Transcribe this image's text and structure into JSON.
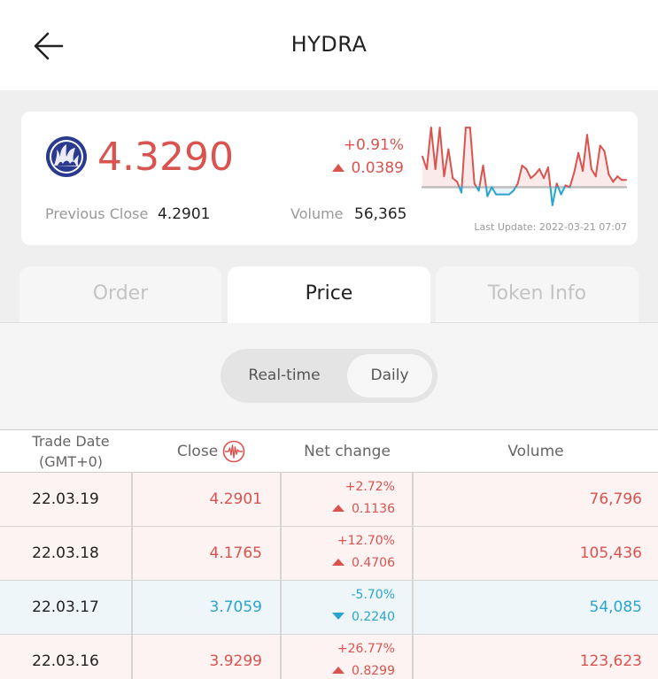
{
  "header": {
    "title": "HYDRA"
  },
  "summary": {
    "price": "4.3290",
    "change_percent": "+0.91%",
    "change_amount": "0.0389",
    "previous_close_label": "Previous Close",
    "previous_close": "4.2901",
    "volume_label": "Volume",
    "volume": "56,365",
    "last_update": "Last Update: 2022-03-21 07:07"
  },
  "tabs": [
    {
      "label": "Order",
      "active": false
    },
    {
      "label": "Price",
      "active": true
    },
    {
      "label": "Token Info",
      "active": false
    }
  ],
  "toggle": {
    "realtime_label": "Real-time",
    "daily_label": "Daily",
    "selected": "Daily"
  },
  "table": {
    "headers": {
      "trade_date_line1": "Trade Date",
      "trade_date_line2": "(GMT+0)",
      "close": "Close",
      "net_change": "Net change",
      "volume": "Volume"
    },
    "rows": [
      {
        "date": "22.03.19",
        "close": "4.2901",
        "pct": "+2.72%",
        "amount": "0.1136",
        "volume": "76,796",
        "direction": "up"
      },
      {
        "date": "22.03.18",
        "close": "4.1765",
        "pct": "+12.70%",
        "amount": "0.4706",
        "volume": "105,436",
        "direction": "up"
      },
      {
        "date": "22.03.17",
        "close": "3.7059",
        "pct": "-5.70%",
        "amount": "0.2240",
        "volume": "54,085",
        "direction": "down"
      },
      {
        "date": "22.03.16",
        "close": "3.9299",
        "pct": "+26.77%",
        "amount": "0.8299",
        "volume": "123,623",
        "direction": "up"
      }
    ]
  },
  "sparkline": {
    "baseline": 4.2901,
    "values": [
      4.46,
      4.39,
      4.62,
      4.39,
      4.62,
      4.35,
      4.5,
      4.34,
      4.32,
      4.26,
      4.62,
      4.62,
      4.31,
      4.27,
      4.41,
      4.24,
      4.29,
      4.25,
      4.25,
      4.25,
      4.25,
      4.27,
      4.31,
      4.41,
      4.39,
      4.34,
      4.36,
      4.39,
      4.34,
      4.4,
      4.19,
      4.31,
      4.25,
      4.3,
      4.29,
      4.37,
      4.48,
      4.38,
      4.58,
      4.39,
      4.35,
      4.52,
      4.49,
      4.36,
      4.32,
      4.35,
      4.33,
      4.33
    ],
    "up_color": "#d9534f",
    "down_color": "#2aa4cf"
  },
  "colors": {
    "up": "#d9534f",
    "down": "#2aa4cf"
  },
  "icons": {
    "back": "arrow-left-icon",
    "logo": "hydra-logo-icon",
    "close_header": "live-pulse-icon"
  }
}
